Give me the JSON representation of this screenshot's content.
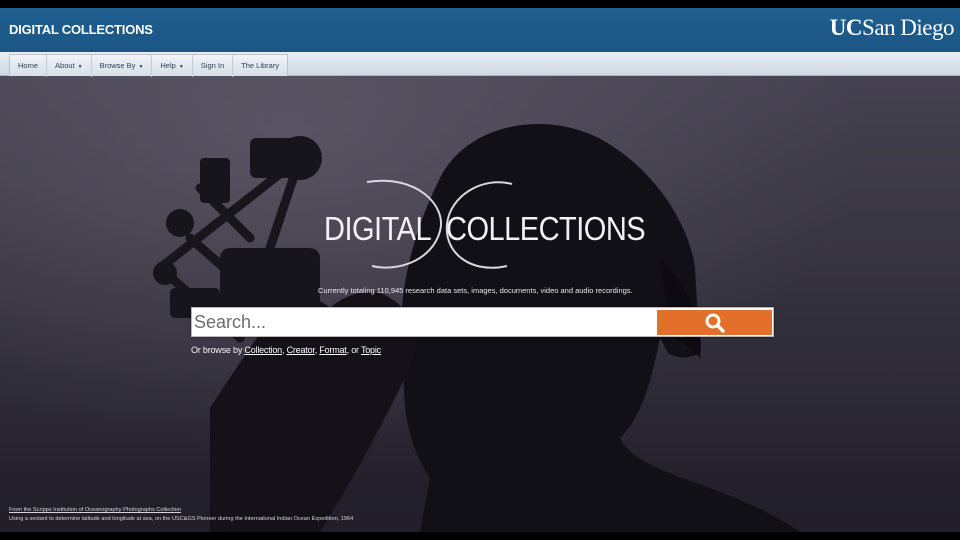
{
  "header": {
    "site_title": "DIGITAL COLLECTIONS",
    "logo_uc": "UC",
    "logo_name": "San Diego"
  },
  "nav": {
    "items": [
      {
        "label": "Home",
        "dropdown": false
      },
      {
        "label": "About",
        "dropdown": true
      },
      {
        "label": "Browse By",
        "dropdown": true
      },
      {
        "label": "Help",
        "dropdown": true
      },
      {
        "label": "Sign In",
        "dropdown": false
      },
      {
        "label": "The Library",
        "dropdown": false
      }
    ]
  },
  "hero": {
    "logo_word_left": "DIGITAL",
    "logo_word_right": "COLLECTIONS",
    "tagline": "Currently totaling 110,945 research data sets, images, documents, video and audio recordings."
  },
  "search": {
    "placeholder": "Search...",
    "button_icon": "search-icon",
    "button_color": "#e2702a"
  },
  "browse": {
    "prefix": "Or browse by ",
    "collection": "Collection",
    "comma1": ", ",
    "creator": "Creator",
    "comma2": ", ",
    "format": "Format",
    "or": ", or ",
    "topic": "Topic"
  },
  "caption": {
    "source_link": "From the Scripps Institution of Oceanography Photographs Collection",
    "description": "Using a sextant to determine latitude and longitude at sea, on the USC&GS Pioneer during the International Indian Ocean Expedition, 1964"
  },
  "colors": {
    "header": "#1f5f8f",
    "accent": "#e2702a"
  }
}
